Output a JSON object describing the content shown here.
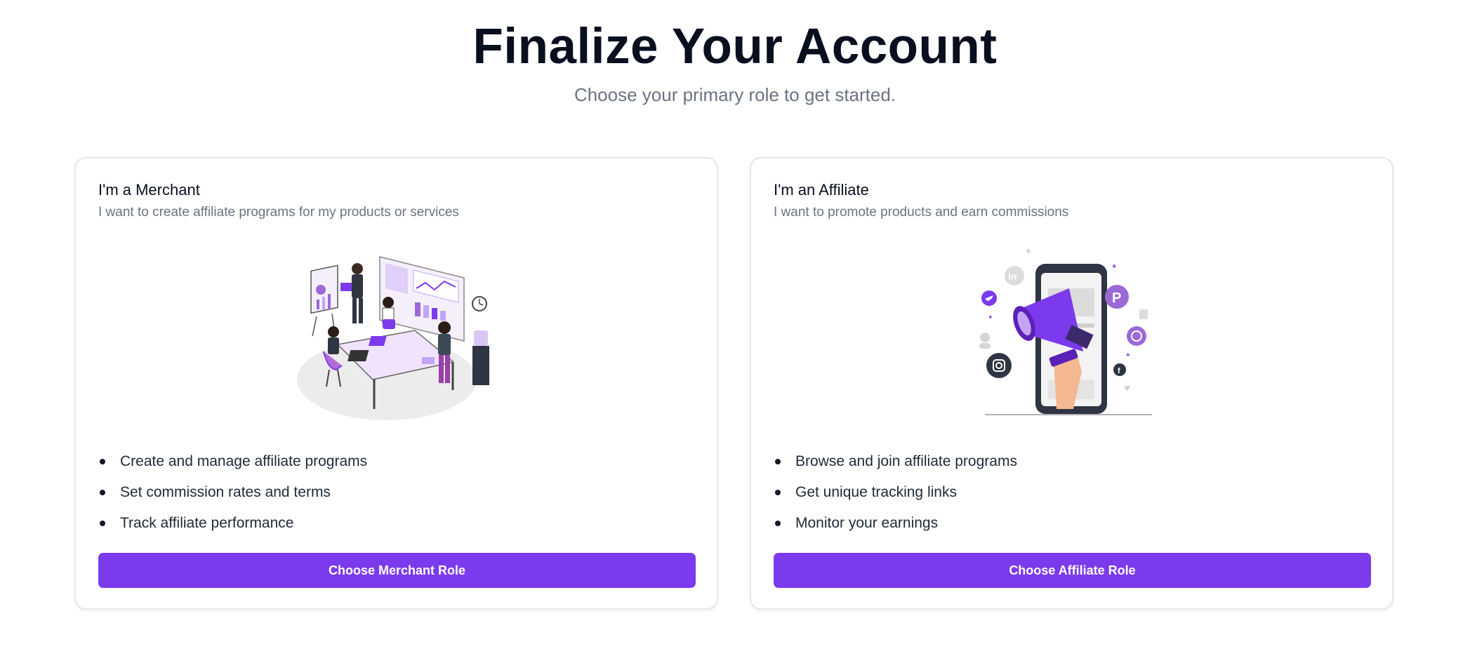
{
  "header": {
    "title": "Finalize Your Account",
    "subtitle": "Choose your primary role to get started."
  },
  "cards": [
    {
      "title": "I'm a Merchant",
      "description": "I want to create affiliate programs for my products or services",
      "illustration": "team-office-illustration",
      "features": [
        "Create and manage affiliate programs",
        "Set commission rates and terms",
        "Track affiliate performance"
      ],
      "button_label": "Choose Merchant Role"
    },
    {
      "title": "I'm an Affiliate",
      "description": "I want to promote products and earn commissions",
      "illustration": "megaphone-phone-illustration",
      "features": [
        "Browse and join affiliate programs",
        "Get unique tracking links",
        "Monitor your earnings"
      ],
      "button_label": "Choose Affiliate Role"
    }
  ],
  "colors": {
    "accent": "#7c3aed",
    "accent_light": "#c4a5f5",
    "text_muted": "#6b7280",
    "border": "#e5e7eb"
  }
}
